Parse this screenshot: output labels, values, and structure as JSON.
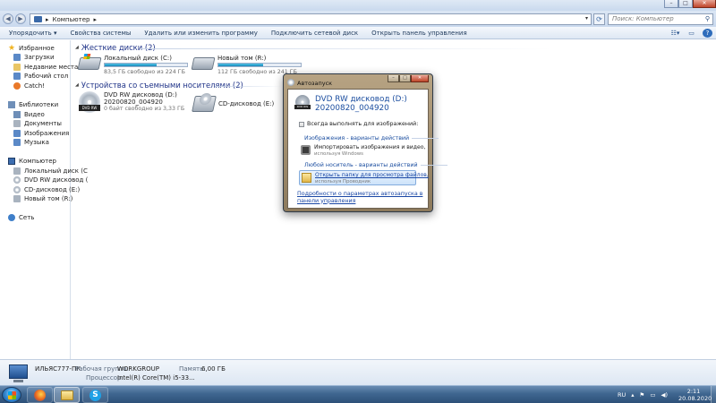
{
  "window": {
    "address_path": "Компьютер",
    "search_placeholder": "Поиск: Компьютер"
  },
  "toolbar": {
    "organize": "Упорядочить ▾",
    "system_properties": "Свойства системы",
    "uninstall": "Удалить или изменить программу",
    "map_drive": "Подключить сетевой диск",
    "control_panel": "Открыть панель управления"
  },
  "nav": {
    "favorites": "Избранное",
    "downloads": "Загрузки",
    "recent": "Недавние места",
    "desktop": "Рабочий стол",
    "catch": "Catch!",
    "libraries": "Библиотеки",
    "video": "Видео",
    "documents": "Документы",
    "images": "Изображения",
    "music": "Музыка",
    "computer": "Компьютер",
    "local_disk": "Локальный диск (С",
    "dvd": "DVD RW дисковод (",
    "cd": "CD-дисковод (E:)",
    "new_vol": "Новый том (R:)",
    "network": "Сеть"
  },
  "content": {
    "hdd_header": "Жесткие диски (2)",
    "removable_header": "Устройства со съемными носителями (2)",
    "drives": [
      {
        "name": "Локальный диск (C:)",
        "free": "83,5 ГБ свободно из 224 ГБ",
        "used_fraction": 0.63
      },
      {
        "name": "Новый том (R:)",
        "free": "112 ГБ свободно из 241 ГБ",
        "used_fraction": 0.54
      }
    ],
    "dvd": {
      "name": "DVD RW дисковод (D:)",
      "label": "20200820_004920",
      "free": "0 байт свободно из 3,33 ГБ",
      "badge": "DVD RW"
    },
    "cd": {
      "name": "CD-дисковод (E:)"
    }
  },
  "details": {
    "pc_name": "ИЛЬЯС777-ПК",
    "workgroup_key": "Рабочая группа:",
    "workgroup_val": "WORKGROUP",
    "memory_key": "Память:",
    "memory_val": "6,00 ГБ",
    "cpu_key": "Процессор:",
    "cpu_val": "Intel(R) Core(TM) i5-33..."
  },
  "dialog": {
    "title": "Автозапуск",
    "drive_line1": "DVD RW дисковод (D:)",
    "drive_line2": "20200820_004920",
    "always": "Всегда выполнять для изображений:",
    "section_images": "Изображения - варианты действий",
    "import_title": "Импортировать изображения и видео,",
    "import_sub": "используя Windows",
    "section_any": "Любой носитель - варианты действий",
    "open_title": "Открыть папку для просмотра файлов,",
    "open_sub": "используя Проводник",
    "footer_link": "Подробности о параметрах автозапуска в панели управления",
    "badge": "DVD RW"
  },
  "taskbar": {
    "lang": "RU",
    "time": "2:11",
    "date": "20.08.2020"
  }
}
